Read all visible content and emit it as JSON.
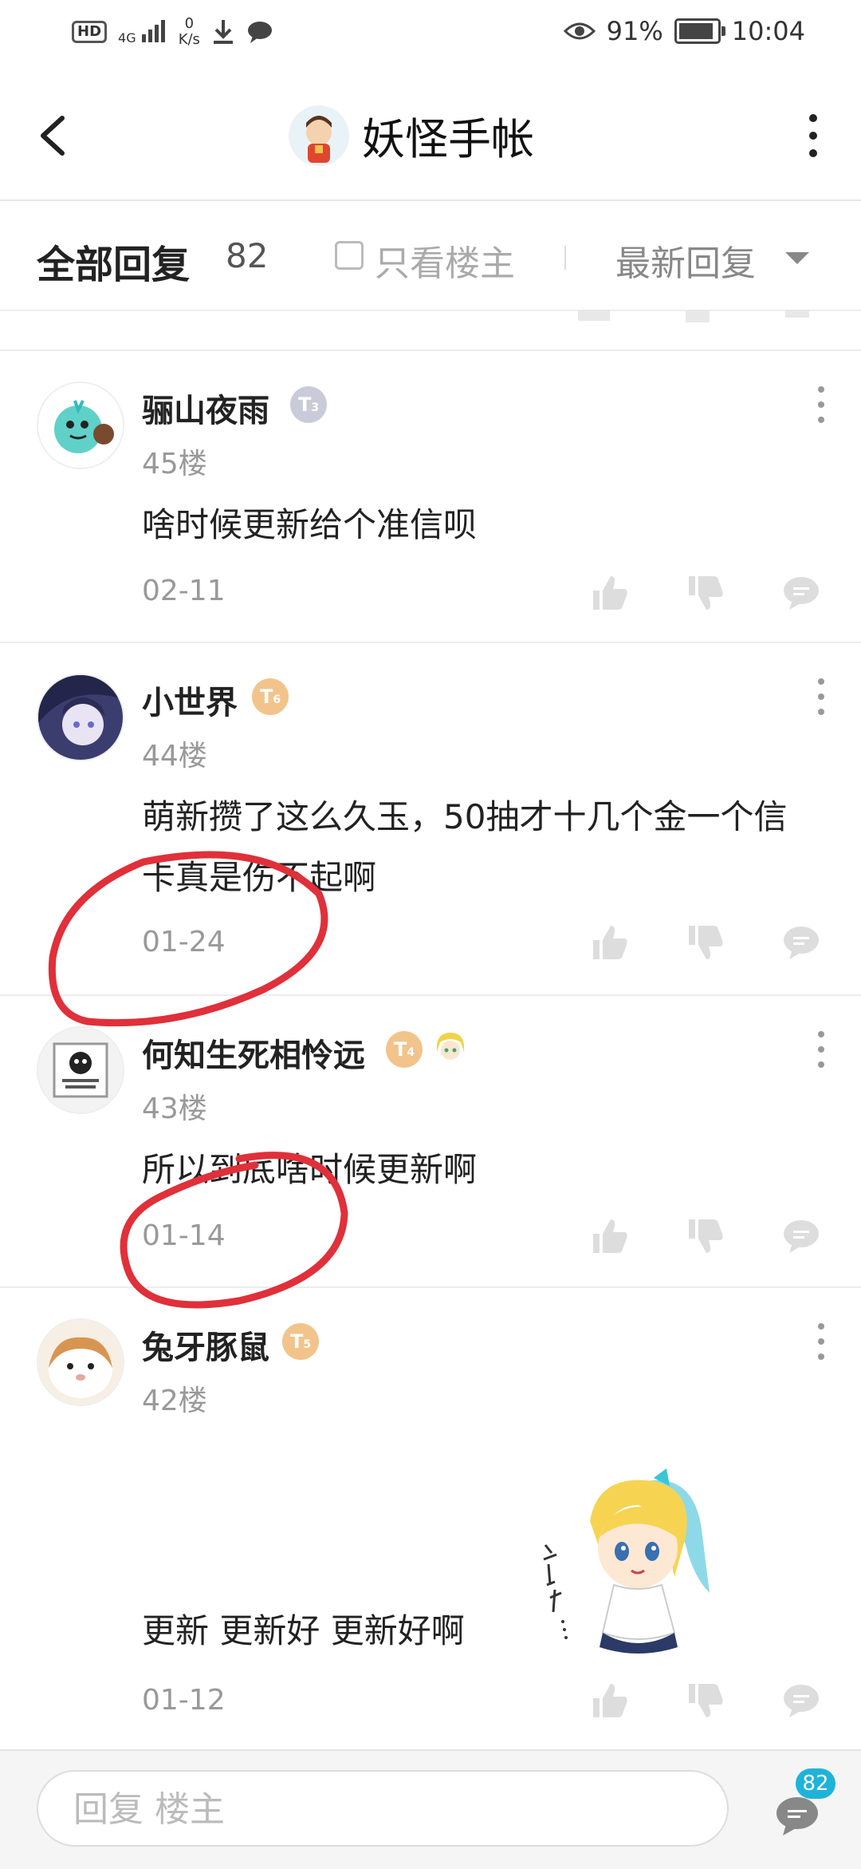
{
  "status_bar": {
    "left": {
      "hd": "HD",
      "network": "4G",
      "speed_value": "0",
      "speed_unit": "K/s"
    },
    "right": {
      "battery_percent": "91%",
      "time": "10:04"
    }
  },
  "header": {
    "title": "妖怪手帐"
  },
  "filter_bar": {
    "all_replies_label": "全部回复",
    "reply_count": "82",
    "only_op_label": "只看楼主",
    "sort_label": "最新回复"
  },
  "posts": [
    {
      "username": "骊山夜雨",
      "level": "3",
      "floor": "45楼",
      "content": "啥时候更新给个准信呗",
      "date": "02-11"
    },
    {
      "username": "小世界",
      "level": "6",
      "floor": "44楼",
      "content": "萌新攒了这么久玉，50抽才十几个金一个信卡真是伤不起啊",
      "date": "01-24"
    },
    {
      "username": "何知生死相怜远",
      "level": "4",
      "floor": "43楼",
      "content": "所以到底啥时候更新啊",
      "date": "01-14"
    },
    {
      "username": "兔牙豚鼠",
      "level": "5",
      "floor": "42楼",
      "content": "更新 更新好 更新好啊",
      "date": "01-12"
    }
  ],
  "reply_bar": {
    "placeholder": "回复  楼主",
    "comment_count": "82"
  },
  "colors": {
    "accent": "#1fb3d9",
    "gold_badge": "#f2c48b",
    "silver_badge": "#c9ccd8",
    "annotation": "#e0303a"
  }
}
